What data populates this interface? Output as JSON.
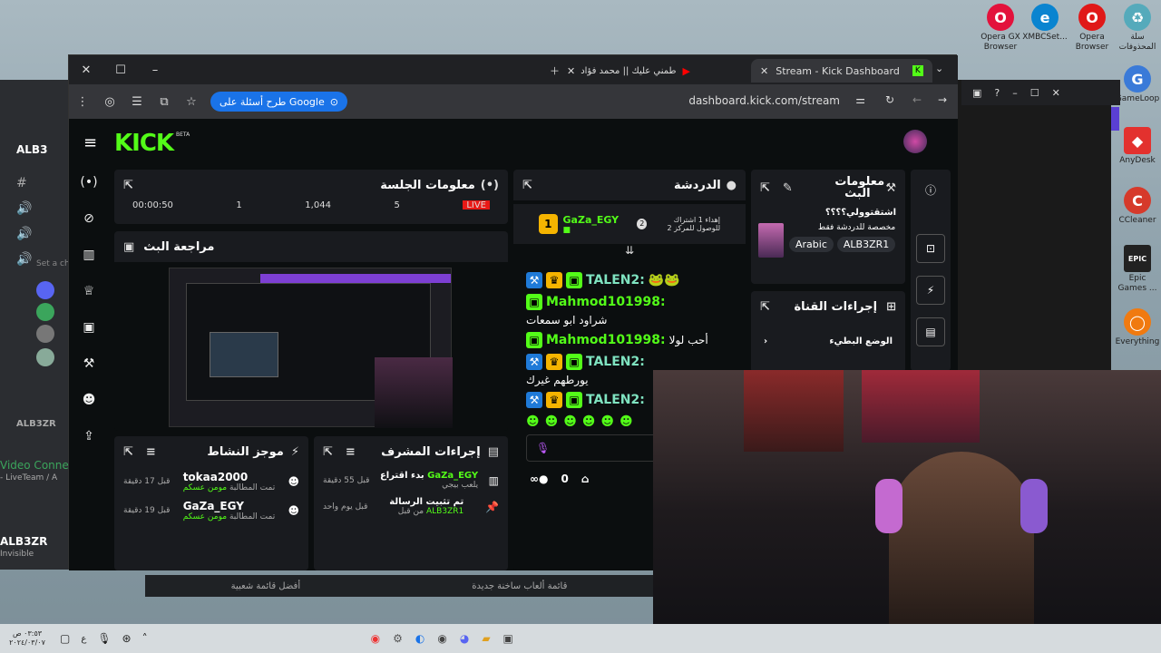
{
  "desktop": {
    "icons": [
      {
        "label": "Opera GX Browser",
        "color": "#e3123c",
        "glyph": "O"
      },
      {
        "label": "XMBCSet...",
        "color": "#0a84d0",
        "glyph": "e"
      },
      {
        "label": "Opera Browser",
        "color": "#e01818",
        "glyph": "O"
      },
      {
        "label": "سلة المحذوفات",
        "color": "#5ab",
        "glyph": "♻"
      },
      {
        "label": "GameLoop",
        "color": "#3a7ad8",
        "glyph": "G"
      },
      {
        "label": "AnyDesk",
        "color": "#e3312e",
        "glyph": "◆"
      },
      {
        "label": "CCleaner",
        "color": "#d63a2b",
        "glyph": "C"
      },
      {
        "label": "Epic Games ...",
        "color": "#222",
        "glyph": "EPIC"
      },
      {
        "label": "Everything",
        "color": "#f07a10",
        "glyph": "◯"
      }
    ],
    "bottom_strip": [
      "أفضل قائمة شعبية",
      "قائمة ألعاب ساخنة جديدة"
    ]
  },
  "discord": {
    "server": "ALB3",
    "section_label": "ALB3ZR",
    "status": "Set a ch",
    "video": "Video Connec",
    "live_team": "- LiveTeam / A",
    "user": "ALB3ZR",
    "user_status": "Invisible"
  },
  "browser": {
    "tabs": [
      {
        "title": "Stream - Kick Dashboard",
        "active": true
      },
      {
        "title": "طمني عليك || محمد فؤاد - YouTube",
        "active": false
      }
    ],
    "google_pill": "طرح أسئلة على Google",
    "url": "dashboard.kick.com/stream"
  },
  "kick": {
    "logo": "KICK",
    "beta": "BETA",
    "session": {
      "title": "معلومات الجلسة",
      "stats": [
        "00:00:50",
        "1",
        "1,044",
        "5",
        "LIVE"
      ]
    },
    "preview": {
      "title": "مراجعة البث"
    },
    "chat": {
      "title": "الدردشة",
      "pinned_user": "GaZa_EGY",
      "pinned_sub": "1",
      "pinned_text": "إهداء 1 اشتراك للوصول للمركز 2",
      "pinned_rank": "2",
      "messages": [
        {
          "user": "TALEN2:",
          "text": "",
          "badges": [
            "mod",
            "crown",
            "sub"
          ],
          "emotes": 2
        },
        {
          "user": "Mahmod101998:",
          "text": "شراود ابو سمعات",
          "badges": [
            "sub"
          ],
          "emotes": 0
        },
        {
          "user": "Mahmod101998:",
          "text": "أحب لولا",
          "badges": [
            "sub"
          ],
          "emotes": 0
        },
        {
          "user": "TALEN2:",
          "text": "يورطهم غيرك",
          "badges": [
            "mod",
            "crown",
            "sub"
          ],
          "emotes": 0
        },
        {
          "user": "TALEN2:",
          "text": "",
          "badges": [
            "mod",
            "crown",
            "sub"
          ],
          "emotes": 0
        }
      ],
      "viewer_count": "0"
    },
    "stream_info": {
      "title": "معلومات البث",
      "stream_title": "اشتقتوولي؟؟؟؟",
      "category": "مخصصة للدردشة فقط",
      "tags": [
        "Arabic",
        "ALB3ZR1"
      ]
    },
    "channel_actions": {
      "title": "إجراءات القناة",
      "item": "الوضع البطيء"
    },
    "activity": {
      "title": "موجز النشاط",
      "items": [
        {
          "user": "tokaa2000",
          "time": "قبل 17 دقيقة",
          "desc": "تمت المطالبة",
          "reward": "مومن عسكم"
        },
        {
          "user": "GaZa_EGY",
          "time": "قبل 19 دقيقة",
          "desc": "تمت المطالبة",
          "reward": "مومن عسكم"
        }
      ]
    },
    "mod_actions": {
      "title": "إجراءات المشرف",
      "items": [
        {
          "title": "بدء اقتراع",
          "user": "GaZa_EGY",
          "sub": "يلعب بيجي",
          "time": "قبل 55 دقيقة"
        },
        {
          "title": "تم تثبيت الرسالة",
          "user": "ALB3ZR1",
          "sub": "من قبل",
          "time": "قبل يوم واحد"
        }
      ]
    }
  },
  "taskbar": {
    "time": "٠٣:٥٣ ص",
    "date": "٢٠٢٤/٠٣/٠٧",
    "lang": "ع"
  }
}
